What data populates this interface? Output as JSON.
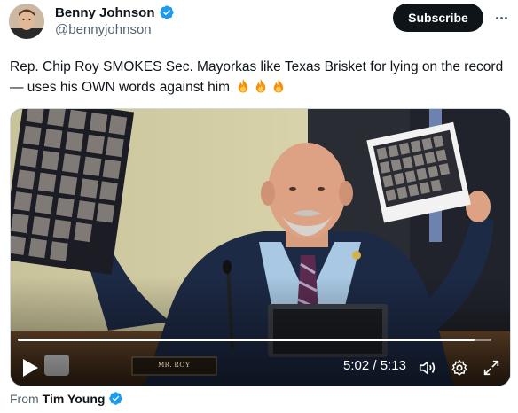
{
  "author": {
    "name": "Benny Johnson",
    "handle": "@bennyjohnson",
    "verified": true,
    "avatar_icon": "profile-photo"
  },
  "subscribe_label": "Subscribe",
  "tweet": {
    "text": "Rep. Chip Roy SMOKES Sec. Mayorkas like Texas Brisket for lying on the record— uses his OWN words against him",
    "emoji": [
      "fire-emoji",
      "fire-emoji",
      "fire-emoji"
    ]
  },
  "video": {
    "placard_text": "MR. ROY",
    "time_current": "5:02",
    "time_separator": "/",
    "time_total": "5:13",
    "progress": 0.965,
    "controls": [
      "play-icon",
      "volume-icon",
      "settings-gear-icon",
      "fullscreen-expand-icon"
    ]
  },
  "attribution": {
    "prefix": "From",
    "name": "Tim Young",
    "verified": true
  },
  "colors": {
    "text": "#0f1419",
    "secondary": "#536471",
    "verified_blue": "#1d9bf0",
    "subscribe_bg": "#0f1419"
  }
}
